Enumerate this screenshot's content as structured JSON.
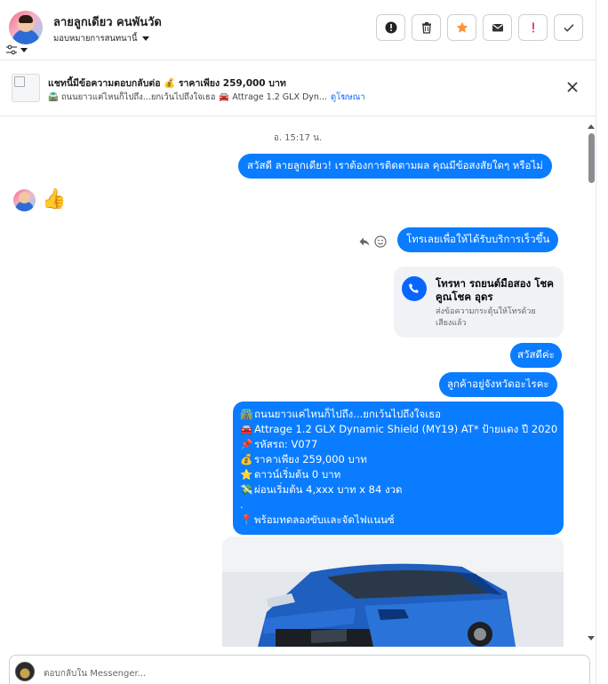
{
  "header": {
    "contact_name": "ลายลูกเดียว คนพันวัด",
    "assign_label": "มอบหมายการสนทนานี้",
    "actions": [
      "mark-spam",
      "delete",
      "star",
      "email",
      "follow-up",
      "done"
    ]
  },
  "ad_banner": {
    "title": "แชทนี้มีข้อความตอบกลับต่อ 💰 ราคาเพียง 259,000 บาท",
    "subtitle_1": "🛣️ ถนนยาวแค่ไหนก็ไปถึง...ยกเว้นไปถึงใจเธอ",
    "subtitle_2": "🚘 Attrage 1.2 GLX Dyn...",
    "link": "ดูโฆษณา"
  },
  "conversation": {
    "timestamp": "อ. 15:17 น.",
    "msg_greeting": "สวัสดี ลายลูกเดียว! เราต้องการติดตามผล คุณมีข้อสงสัยใดๆ หรือไม่",
    "incoming_reaction": "👍",
    "msg_call_prompt": "โทรเลยเพื่อให้ได้รับบริการเร็วขึ้น",
    "call_card": {
      "title": "โทรหา รถยนต์มือสอง โชคคูณโชค อุดร",
      "subtitle": "ส่งข้อความกระตุ้นให้โทรด้วยเสียงแล้ว"
    },
    "msg_hello": "สวัสดีค่ะ",
    "msg_province": "ลูกค้าอยู่จังหวัดอะไรคะ",
    "listing": {
      "lines": [
        {
          "emoji": "🛣️",
          "text": "ถนนยาวแค่ไหนก็ไปถึง...ยกเว้นไปถึงใจเธอ"
        },
        {
          "emoji": "🚘",
          "text": "Attrage 1.2 GLX Dynamic Shield (MY19) AT* ป้ายแดง ปี 2020"
        },
        {
          "emoji": "📌",
          "text": "รหัสรถ: V077"
        },
        {
          "emoji": "💰",
          "text": "ราคาเพียง 259,000 บาท"
        },
        {
          "emoji": "⭐",
          "text": "ดาวน์เริ่มต้น 0 บาท"
        },
        {
          "emoji": "💸",
          "text": "ผ่อนเริ่มต้น 4,xxx บาท x 84 งวด"
        },
        {
          "emoji": "",
          "text": "."
        },
        {
          "emoji": "📍",
          "text": "พร้อมทดลองขับและจัดไฟแนนซ์"
        }
      ]
    }
  },
  "composer": {
    "placeholder": "ตอบกลับใน Messenger..."
  },
  "colors": {
    "bubble_blue": "#0a7cff",
    "accent_blue": "#0866ff",
    "star_orange": "#f7923a",
    "alert_red": "#e41e3f"
  }
}
